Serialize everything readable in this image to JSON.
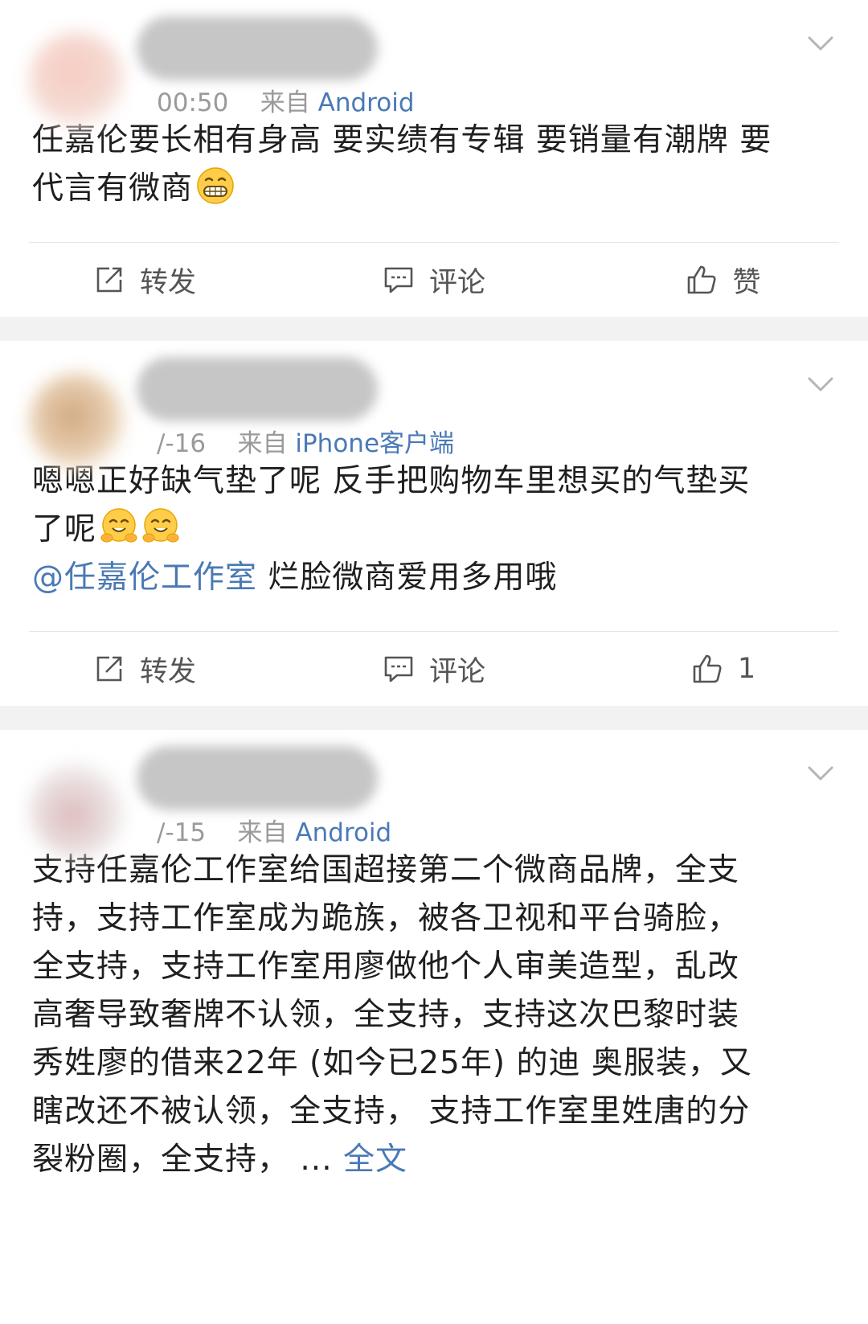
{
  "posts": [
    {
      "meta_time": "00:50",
      "meta_source_prefix": "来自",
      "meta_source": "Android",
      "lines": [
        "任嘉伦要长相有身高 要实绩有专辑 要销量有潮牌 要",
        "代言有微商"
      ],
      "emoji": "grin-emoji",
      "actions": {
        "repost": "转发",
        "comment": "评论",
        "like": "赞"
      }
    },
    {
      "meta_time": "/-16",
      "meta_source_prefix": "来自",
      "meta_source": "iPhone客户端",
      "lines": [
        "嗯嗯正好缺气垫了呢 反手把购物车里想买的气垫买",
        "了呢"
      ],
      "emoji": "hug-emoji",
      "mention": "@任嘉伦工作室",
      "mention_tail": " 烂脸微商爱用多用哦",
      "actions": {
        "repost": "转发",
        "comment": "评论",
        "like": "1"
      }
    },
    {
      "meta_time": "/-15",
      "meta_source_prefix": "来自",
      "meta_source": "Android",
      "lines": [
        "支持任嘉伦工作室给国超接第二个微商品牌，全支",
        "持，支持工作室成为跪族，被各卫视和平台骑脸，",
        "全支持，支持工作室用廖做他个人审美造型，乱改",
        "高奢导致奢牌不认领，全支持，支持这次巴黎时装",
        "秀姓廖的借来22年 (如今已25年) 的迪 奥服装，又",
        "瞎改还不被认领，全支持， 支持工作室里姓唐的分",
        "裂粉圈，全支持，  ... "
      ],
      "fulltext": "全文"
    }
  ],
  "colors": {
    "link": "#4a79b5",
    "separator": "#f2f2f2",
    "meta": "#9a9a9a"
  }
}
